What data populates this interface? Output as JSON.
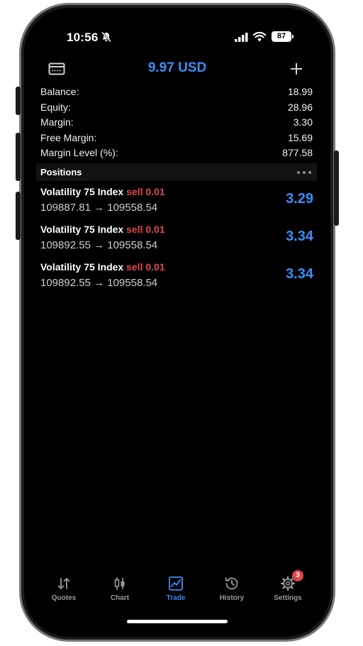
{
  "status": {
    "time": "10:56",
    "battery": "87"
  },
  "header": {
    "title": "9.97 USD",
    "left_icon": "card-icon",
    "right_icon": "plus-icon"
  },
  "account": [
    {
      "label": "Balance:",
      "value": "18.99"
    },
    {
      "label": "Equity:",
      "value": "28.96"
    },
    {
      "label": "Margin:",
      "value": "3.30"
    },
    {
      "label": "Free Margin:",
      "value": "15.69"
    },
    {
      "label": "Margin Level (%):",
      "value": "877.58"
    }
  ],
  "positions": {
    "title": "Positions",
    "items": [
      {
        "symbol": "Volatility 75 Index",
        "side": "sell 0.01",
        "prices": "109887.81 → 109558.54",
        "profit": "3.29"
      },
      {
        "symbol": "Volatility 75 Index",
        "side": "sell 0.01",
        "prices": "109892.55 → 109558.54",
        "profit": "3.34"
      },
      {
        "symbol": "Volatility 75 Index",
        "side": "sell 0.01",
        "prices": "109892.55 → 109558.54",
        "profit": "3.34"
      }
    ]
  },
  "tabs": [
    {
      "label": "Quotes",
      "icon": "quotes-icon"
    },
    {
      "label": "Chart",
      "icon": "candlestick-icon"
    },
    {
      "label": "Trade",
      "icon": "trade-chart-icon",
      "active": true
    },
    {
      "label": "History",
      "icon": "history-icon"
    },
    {
      "label": "Settings",
      "icon": "gear-icon",
      "badge": "3"
    }
  ],
  "colors": {
    "accent": "#3a8ef6",
    "sell": "#e0464b",
    "background": "#000000"
  }
}
